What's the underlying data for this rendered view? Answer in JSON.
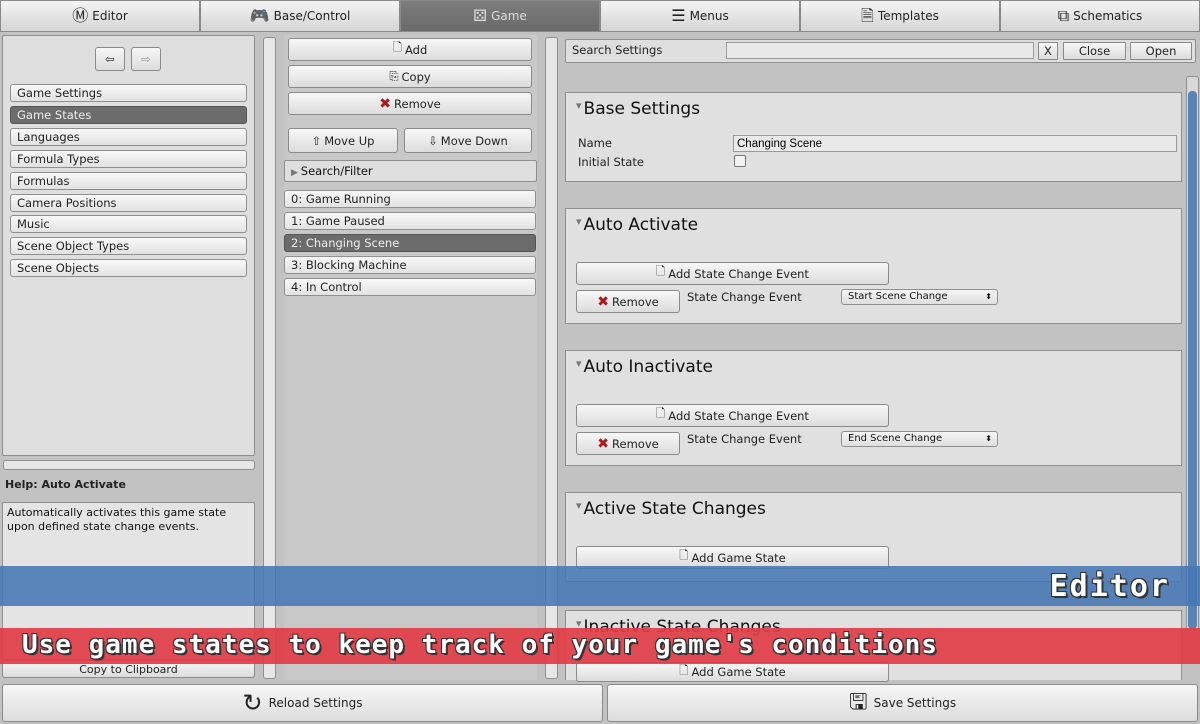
{
  "tabs": [
    {
      "label": "Editor",
      "icon": "editor-logo-icon",
      "active": false
    },
    {
      "label": "Base/Control",
      "icon": "gamepad-icon",
      "active": false
    },
    {
      "label": "Game",
      "icon": "dice-icon",
      "active": true
    },
    {
      "label": "Menus",
      "icon": "menu-icon",
      "active": false
    },
    {
      "label": "Templates",
      "icon": "document-icon",
      "active": false
    },
    {
      "label": "Schematics",
      "icon": "schematic-icon",
      "active": false
    }
  ],
  "sidebar": {
    "items": [
      "Game Settings",
      "Game States",
      "Languages",
      "Formula Types",
      "Formulas",
      "Camera Positions",
      "Music",
      "Scene Object Types",
      "Scene Objects"
    ],
    "selected": "Game States",
    "help_title": "Help: Auto Activate",
    "help_text": "Automatically activates this game state upon defined state change events.",
    "copy_label": "Copy to Clipboard"
  },
  "list": {
    "add": "Add",
    "copy": "Copy",
    "remove": "Remove",
    "move_up": "Move Up",
    "move_down": "Move Down",
    "search_filter": "Search/Filter",
    "items": [
      "0: Game Running",
      "1: Game Paused",
      "2: Changing Scene",
      "3: Blocking Machine",
      "4: In Control"
    ],
    "selected": "2: Changing Scene"
  },
  "settings": {
    "search_label": "Search Settings",
    "search_value": "",
    "clear": "X",
    "close": "Close",
    "open": "Open",
    "base": {
      "title": "Base Settings",
      "name_label": "Name",
      "name_value": "Changing Scene",
      "initial_label": "Initial State",
      "initial_checked": false
    },
    "auto_activate": {
      "title": "Auto Activate",
      "add": "Add State Change Event",
      "remove": "Remove",
      "event_label": "State Change Event",
      "event_value": "Start Scene Change"
    },
    "auto_inactivate": {
      "title": "Auto Inactivate",
      "add": "Add State Change Event",
      "remove": "Remove",
      "event_label": "State Change Event",
      "event_value": "End Scene Change"
    },
    "active_changes": {
      "title": "Active State Changes",
      "add": "Add Game State"
    },
    "inactive_changes": {
      "title": "Inactive State Changes",
      "add": "Add Game State"
    }
  },
  "footer": {
    "reload": "Reload Settings",
    "save": "Save Settings"
  },
  "overlay": {
    "section": "Editor",
    "caption": "Use game states to keep track of your game's conditions"
  },
  "colors": {
    "banner_blue": "#4678b4",
    "banner_red": "#e13c46",
    "selected": "#6c6c6c"
  }
}
